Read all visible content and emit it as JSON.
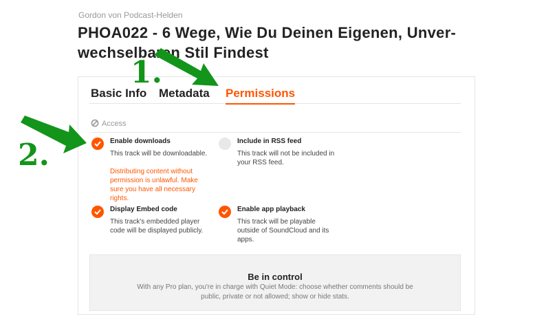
{
  "header": {
    "creator": "Gordon von Podcast-Helden",
    "title": "PHOA022 - 6 Wege, Wie Du Deinen Eigenen, Unver-wechselbaren Stil Findest"
  },
  "tabs": [
    {
      "label": "Basic Info"
    },
    {
      "label": "Metadata"
    },
    {
      "label": "Permissions",
      "active": true
    }
  ],
  "access": {
    "label": "Access"
  },
  "options": {
    "enable_downloads": {
      "name": "Enable downloads",
      "desc": "This track will be downloadable.",
      "warning": "Distributing content without permission is unlawful. Make sure you have all necessary rights.",
      "checked": true
    },
    "rss": {
      "name": "Include in RSS feed",
      "desc": "This track will not be included in your RSS feed.",
      "checked": false
    },
    "embed": {
      "name": "Display Embed code",
      "desc": "This track's embedded player code will be displayed publicly.",
      "checked": true
    },
    "app_playback": {
      "name": "Enable app playback",
      "desc": "This track will be playable outside of SoundCloud and its apps.",
      "checked": true
    }
  },
  "promo": {
    "heading": "Be in control",
    "text": "With any Pro plan, you're in charge with Quiet Mode: choose whether comments should be public, private or not allowed; show or hide stats."
  },
  "annotations": {
    "step1": "1.",
    "step2": "2."
  },
  "colors": {
    "accent": "#ff5500",
    "annotation": "#13941a"
  }
}
